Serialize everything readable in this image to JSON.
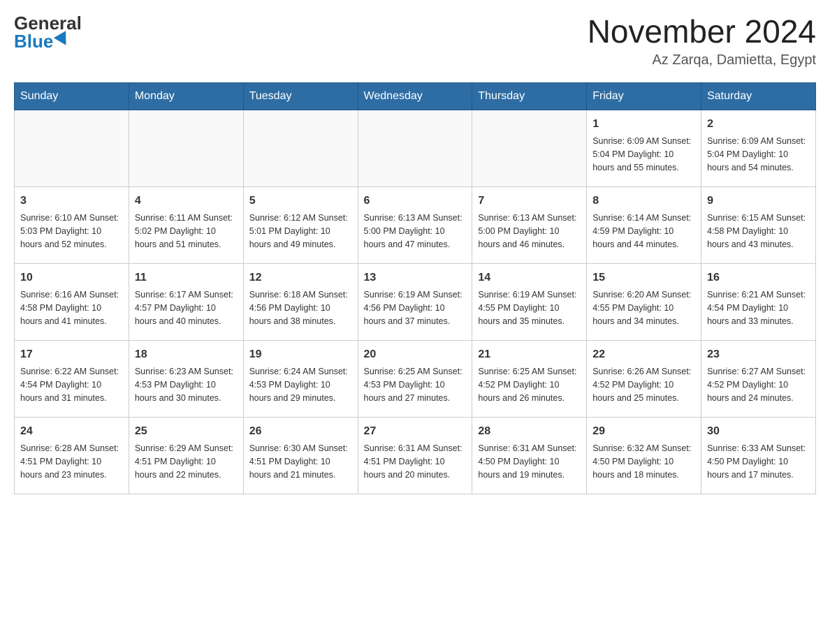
{
  "header": {
    "logo_general": "General",
    "logo_blue": "Blue",
    "month_title": "November 2024",
    "location": "Az Zarqa, Damietta, Egypt"
  },
  "days_of_week": [
    "Sunday",
    "Monday",
    "Tuesday",
    "Wednesday",
    "Thursday",
    "Friday",
    "Saturday"
  ],
  "weeks": [
    [
      {
        "day": "",
        "info": ""
      },
      {
        "day": "",
        "info": ""
      },
      {
        "day": "",
        "info": ""
      },
      {
        "day": "",
        "info": ""
      },
      {
        "day": "",
        "info": ""
      },
      {
        "day": "1",
        "info": "Sunrise: 6:09 AM\nSunset: 5:04 PM\nDaylight: 10 hours and 55 minutes."
      },
      {
        "day": "2",
        "info": "Sunrise: 6:09 AM\nSunset: 5:04 PM\nDaylight: 10 hours and 54 minutes."
      }
    ],
    [
      {
        "day": "3",
        "info": "Sunrise: 6:10 AM\nSunset: 5:03 PM\nDaylight: 10 hours and 52 minutes."
      },
      {
        "day": "4",
        "info": "Sunrise: 6:11 AM\nSunset: 5:02 PM\nDaylight: 10 hours and 51 minutes."
      },
      {
        "day": "5",
        "info": "Sunrise: 6:12 AM\nSunset: 5:01 PM\nDaylight: 10 hours and 49 minutes."
      },
      {
        "day": "6",
        "info": "Sunrise: 6:13 AM\nSunset: 5:00 PM\nDaylight: 10 hours and 47 minutes."
      },
      {
        "day": "7",
        "info": "Sunrise: 6:13 AM\nSunset: 5:00 PM\nDaylight: 10 hours and 46 minutes."
      },
      {
        "day": "8",
        "info": "Sunrise: 6:14 AM\nSunset: 4:59 PM\nDaylight: 10 hours and 44 minutes."
      },
      {
        "day": "9",
        "info": "Sunrise: 6:15 AM\nSunset: 4:58 PM\nDaylight: 10 hours and 43 minutes."
      }
    ],
    [
      {
        "day": "10",
        "info": "Sunrise: 6:16 AM\nSunset: 4:58 PM\nDaylight: 10 hours and 41 minutes."
      },
      {
        "day": "11",
        "info": "Sunrise: 6:17 AM\nSunset: 4:57 PM\nDaylight: 10 hours and 40 minutes."
      },
      {
        "day": "12",
        "info": "Sunrise: 6:18 AM\nSunset: 4:56 PM\nDaylight: 10 hours and 38 minutes."
      },
      {
        "day": "13",
        "info": "Sunrise: 6:19 AM\nSunset: 4:56 PM\nDaylight: 10 hours and 37 minutes."
      },
      {
        "day": "14",
        "info": "Sunrise: 6:19 AM\nSunset: 4:55 PM\nDaylight: 10 hours and 35 minutes."
      },
      {
        "day": "15",
        "info": "Sunrise: 6:20 AM\nSunset: 4:55 PM\nDaylight: 10 hours and 34 minutes."
      },
      {
        "day": "16",
        "info": "Sunrise: 6:21 AM\nSunset: 4:54 PM\nDaylight: 10 hours and 33 minutes."
      }
    ],
    [
      {
        "day": "17",
        "info": "Sunrise: 6:22 AM\nSunset: 4:54 PM\nDaylight: 10 hours and 31 minutes."
      },
      {
        "day": "18",
        "info": "Sunrise: 6:23 AM\nSunset: 4:53 PM\nDaylight: 10 hours and 30 minutes."
      },
      {
        "day": "19",
        "info": "Sunrise: 6:24 AM\nSunset: 4:53 PM\nDaylight: 10 hours and 29 minutes."
      },
      {
        "day": "20",
        "info": "Sunrise: 6:25 AM\nSunset: 4:53 PM\nDaylight: 10 hours and 27 minutes."
      },
      {
        "day": "21",
        "info": "Sunrise: 6:25 AM\nSunset: 4:52 PM\nDaylight: 10 hours and 26 minutes."
      },
      {
        "day": "22",
        "info": "Sunrise: 6:26 AM\nSunset: 4:52 PM\nDaylight: 10 hours and 25 minutes."
      },
      {
        "day": "23",
        "info": "Sunrise: 6:27 AM\nSunset: 4:52 PM\nDaylight: 10 hours and 24 minutes."
      }
    ],
    [
      {
        "day": "24",
        "info": "Sunrise: 6:28 AM\nSunset: 4:51 PM\nDaylight: 10 hours and 23 minutes."
      },
      {
        "day": "25",
        "info": "Sunrise: 6:29 AM\nSunset: 4:51 PM\nDaylight: 10 hours and 22 minutes."
      },
      {
        "day": "26",
        "info": "Sunrise: 6:30 AM\nSunset: 4:51 PM\nDaylight: 10 hours and 21 minutes."
      },
      {
        "day": "27",
        "info": "Sunrise: 6:31 AM\nSunset: 4:51 PM\nDaylight: 10 hours and 20 minutes."
      },
      {
        "day": "28",
        "info": "Sunrise: 6:31 AM\nSunset: 4:50 PM\nDaylight: 10 hours and 19 minutes."
      },
      {
        "day": "29",
        "info": "Sunrise: 6:32 AM\nSunset: 4:50 PM\nDaylight: 10 hours and 18 minutes."
      },
      {
        "day": "30",
        "info": "Sunrise: 6:33 AM\nSunset: 4:50 PM\nDaylight: 10 hours and 17 minutes."
      }
    ]
  ]
}
